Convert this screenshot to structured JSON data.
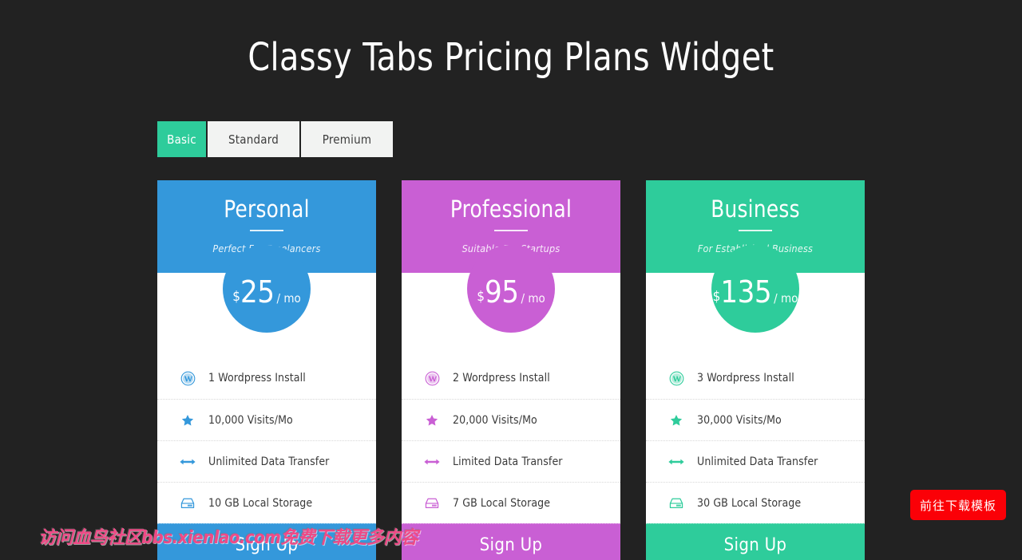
{
  "page": {
    "title": "Classy Tabs Pricing Plans Widget",
    "background_color": "#222222"
  },
  "tabs": {
    "items": [
      {
        "label": "Basic",
        "active": true
      },
      {
        "label": "Standard",
        "active": false
      },
      {
        "label": "Premium",
        "active": false
      }
    ],
    "active_color": "#2ecc9b",
    "inactive_color": "#f2f3f2"
  },
  "plans": [
    {
      "name": "Personal",
      "tagline": "Perfect For Freelancers",
      "currency": "$",
      "amount": "25",
      "period": "/ mo",
      "color": "#3498db",
      "cta": "Sign Up",
      "features": [
        {
          "icon": "wordpress-icon",
          "text": "1 Wordpress Install"
        },
        {
          "icon": "star-icon",
          "text": "10,000 Visits/Mo"
        },
        {
          "icon": "arrows-horizontal-icon",
          "text": "Unlimited Data Transfer"
        },
        {
          "icon": "hard-drive-icon",
          "text": "10 GB Local Storage"
        }
      ]
    },
    {
      "name": "Professional",
      "tagline": "Suitable For Startups",
      "currency": "$",
      "amount": "95",
      "period": "/ mo",
      "color": "#c95fd4",
      "cta": "Sign Up",
      "features": [
        {
          "icon": "wordpress-icon",
          "text": "2 Wordpress Install"
        },
        {
          "icon": "star-icon",
          "text": "20,000 Visits/Mo"
        },
        {
          "icon": "arrows-horizontal-icon",
          "text": "Limited Data Transfer"
        },
        {
          "icon": "hard-drive-icon",
          "text": "7 GB Local Storage"
        }
      ]
    },
    {
      "name": "Business",
      "tagline": "For Established Business",
      "currency": "$",
      "amount": "135",
      "period": "/ mo",
      "color": "#2ecc9b",
      "cta": "Sign Up",
      "features": [
        {
          "icon": "wordpress-icon",
          "text": "3 Wordpress Install"
        },
        {
          "icon": "star-icon",
          "text": "30,000 Visits/Mo"
        },
        {
          "icon": "arrows-horizontal-icon",
          "text": "Unlimited Data Transfer"
        },
        {
          "icon": "hard-drive-icon",
          "text": "30 GB Local Storage"
        }
      ]
    }
  ],
  "watermark": {
    "text": "访问血鸟社区bbs.xienlao.com免费下载更多内容",
    "color": "#ef4a86"
  },
  "download_button": {
    "label": "前往下载模板",
    "color": "#fb0007"
  }
}
